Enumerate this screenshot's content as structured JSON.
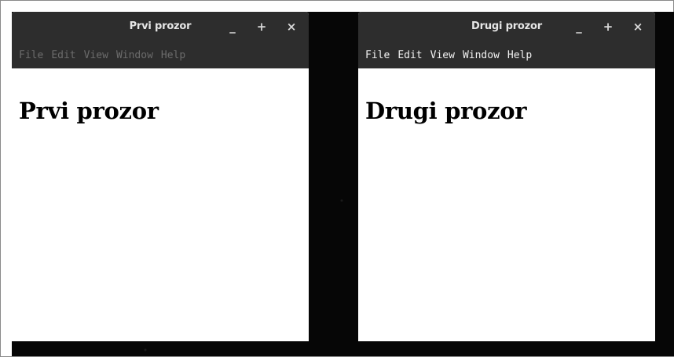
{
  "windows": [
    {
      "title": "Prvi prozor",
      "controls": {
        "minimize": "_",
        "maximize": "+",
        "close": "×"
      },
      "menu": [
        "File",
        "Edit",
        "View",
        "Window",
        "Help"
      ],
      "menu_state": "inactive",
      "content_heading": "Prvi prozor"
    },
    {
      "title": "Drugi prozor",
      "controls": {
        "minimize": "_",
        "maximize": "+",
        "close": "×"
      },
      "menu": [
        "File",
        "Edit",
        "View",
        "Window",
        "Help"
      ],
      "menu_state": "active",
      "content_heading": "Drugi prozor"
    }
  ],
  "colors": {
    "titlebar": "#2d2d2d",
    "desktop": "#060606",
    "menu_inactive_text": "#6c6c6c",
    "menu_active_text": "#f2f2f2"
  }
}
